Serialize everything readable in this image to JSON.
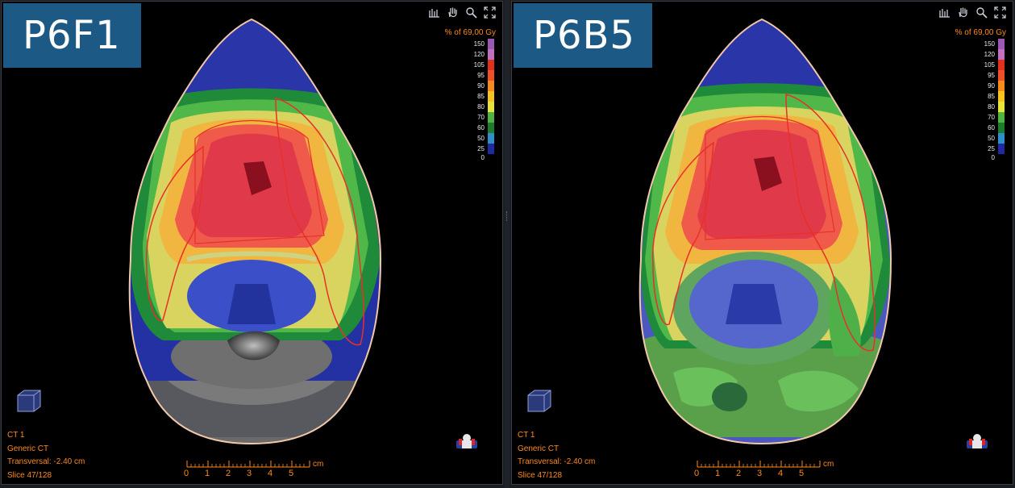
{
  "panels": [
    {
      "id": "left",
      "label": "P6F1",
      "dose_title": "% of 69,00 Gy",
      "legend": [
        {
          "value": "150",
          "color": "#9b59b6"
        },
        {
          "value": "120",
          "color": "#c36fbf"
        },
        {
          "value": "105",
          "color": "#e0301e"
        },
        {
          "value": "95",
          "color": "#f05028"
        },
        {
          "value": "90",
          "color": "#f88a1e"
        },
        {
          "value": "85",
          "color": "#f7c31e"
        },
        {
          "value": "80",
          "color": "#e7e43a"
        },
        {
          "value": "70",
          "color": "#4fb541"
        },
        {
          "value": "60",
          "color": "#1d7d2d"
        },
        {
          "value": "50",
          "color": "#2f8fc9"
        },
        {
          "value": "25",
          "color": "#1f2aa0"
        }
      ],
      "legend_end": "0",
      "info": [
        "CT 1",
        "Generic CT",
        "Transversal: -2.40 cm",
        "Slice 47/128"
      ],
      "ruler": {
        "ticks": [
          "0",
          "1",
          "2",
          "3",
          "4",
          "5"
        ],
        "unit": "cm"
      },
      "tools": [
        "dose-profile-icon",
        "pan-hand-icon",
        "zoom-icon",
        "fit-to-window-icon"
      ]
    },
    {
      "id": "right",
      "label": "P6B5",
      "dose_title": "% of 69,00 Gy",
      "legend": [
        {
          "value": "150",
          "color": "#9b59b6"
        },
        {
          "value": "120",
          "color": "#c36fbf"
        },
        {
          "value": "105",
          "color": "#e0301e"
        },
        {
          "value": "95",
          "color": "#f05028"
        },
        {
          "value": "90",
          "color": "#f88a1e"
        },
        {
          "value": "85",
          "color": "#f7c31e"
        },
        {
          "value": "80",
          "color": "#e7e43a"
        },
        {
          "value": "70",
          "color": "#4fb541"
        },
        {
          "value": "60",
          "color": "#1d7d2d"
        },
        {
          "value": "50",
          "color": "#2f8fc9"
        },
        {
          "value": "25",
          "color": "#1f2aa0"
        }
      ],
      "legend_end": "0",
      "info": [
        "CT 1",
        "Generic CT",
        "Transversal: -2.40 cm",
        "Slice 47/128"
      ],
      "ruler": {
        "ticks": [
          "0",
          "1",
          "2",
          "3",
          "4",
          "5"
        ],
        "unit": "cm"
      },
      "tools": [
        "dose-profile-icon",
        "pan-hand-icon",
        "zoom-icon",
        "fit-to-window-icon"
      ]
    }
  ]
}
